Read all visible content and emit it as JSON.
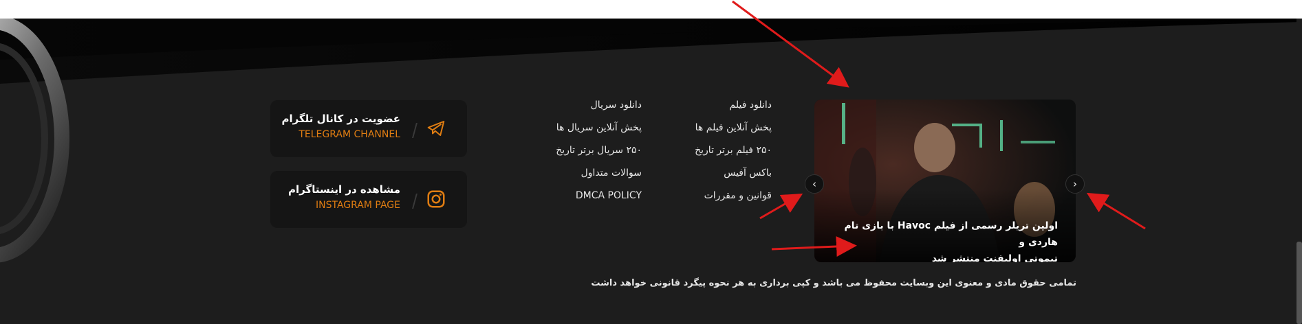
{
  "colors": {
    "accent": "#e07d12",
    "annotation_arrow": "#e01b1b",
    "background": "#1d1d1d",
    "card": "#151515"
  },
  "slider": {
    "caption_line1": "اولین تریلر رسمی از فیلم Havoc با بازی تام هاردی و",
    "caption_line2": "تیموتی اولیفنت منتشر شد",
    "prev_icon": "chevron-left-icon",
    "next_icon": "chevron-right-icon"
  },
  "links_col1": [
    "دانلود فیلم",
    "پخش آنلاین فیلم ها",
    "۲۵۰ فیلم برتر تاریخ",
    "باکس آفیس",
    "قوانین و مقررات"
  ],
  "links_col2": [
    "دانلود سریال",
    "پخش آنلاین سریال ها",
    "۲۵۰ سریال برتر تاریخ",
    "سوالات متداول",
    "DMCA POLICY"
  ],
  "social": {
    "telegram": {
      "title": "عضویت در کانال تلگرام",
      "subtitle": "TELEGRAM CHANNEL",
      "icon": "telegram-icon"
    },
    "instagram": {
      "title": "مشاهده در اینستاگرام",
      "subtitle": "INSTAGRAM PAGE",
      "icon": "instagram-icon"
    }
  },
  "copyright": "تمامی حقوق مادی و معنوی این وبسایت محفوظ می باشد و کپی برداری به هر نحوه پیگرد قانونی خواهد داشت"
}
